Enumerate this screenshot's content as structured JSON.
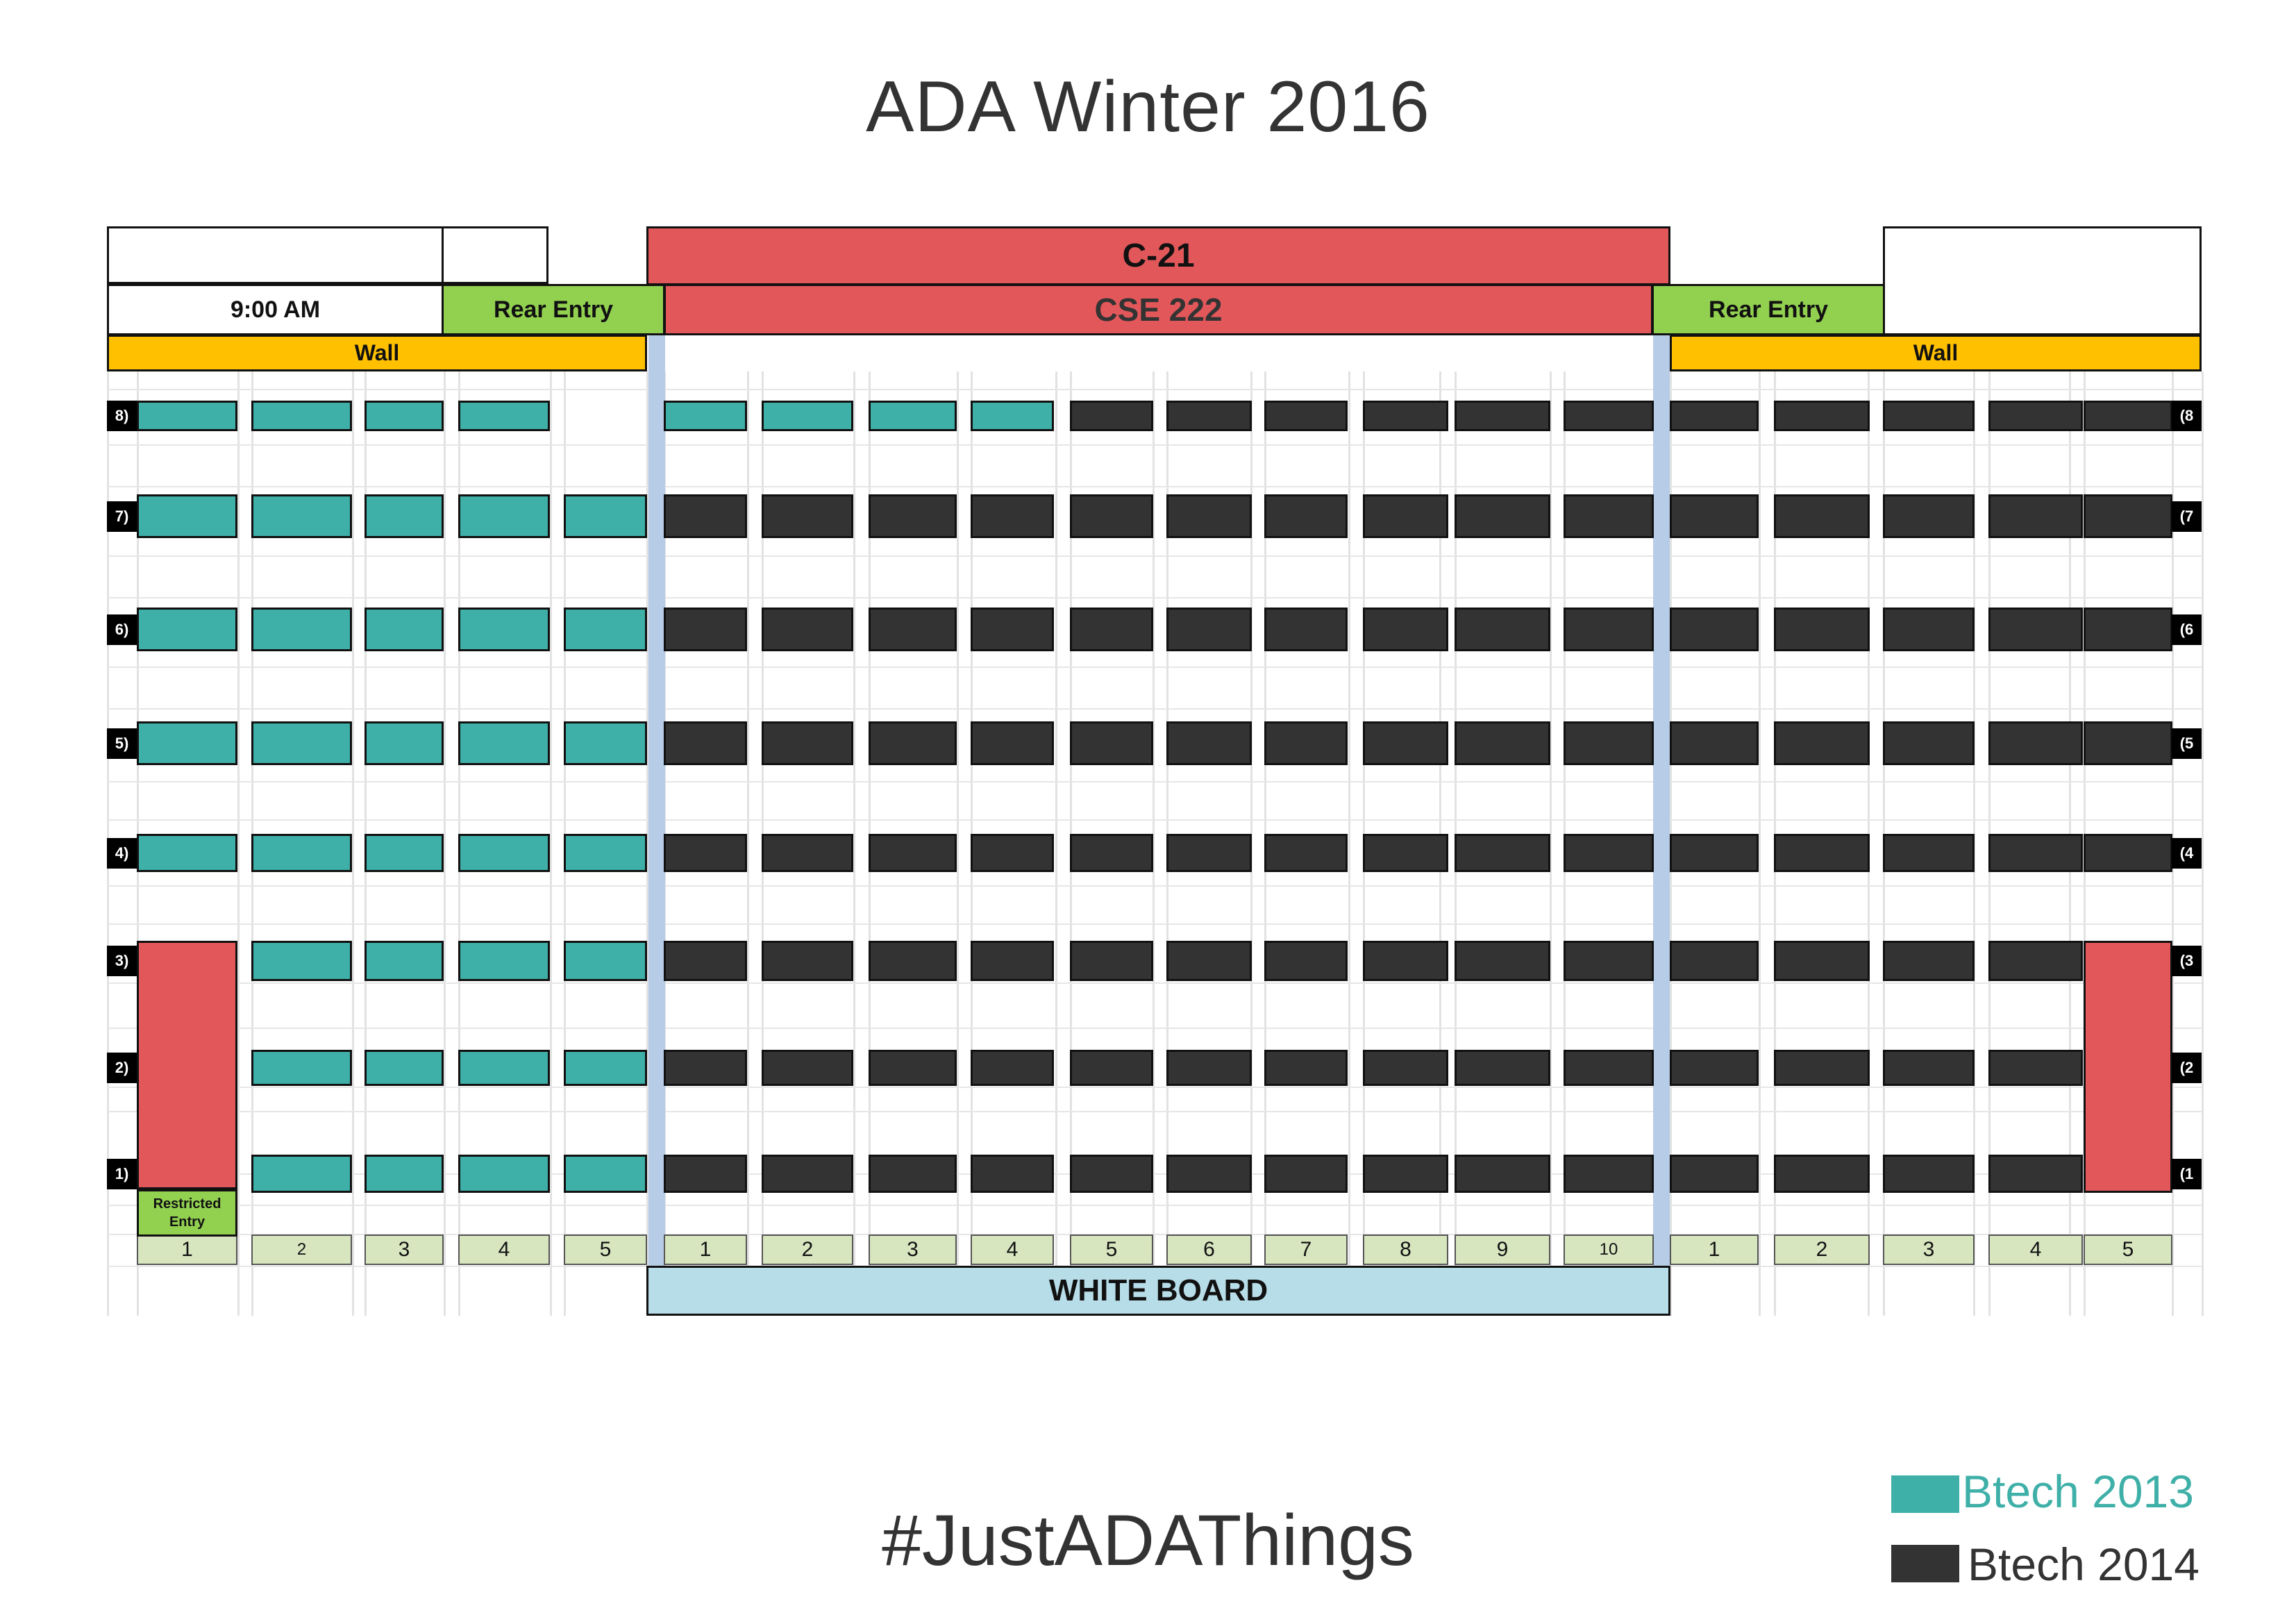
{
  "title": "ADA Winter 2016",
  "hashtag": "#JustADAThings",
  "header": {
    "c21": "C-21",
    "course": "CSE 222",
    "time": "9:00 AM",
    "rear_entry_left": "Rear Entry",
    "rear_entry_right": "Rear Entry",
    "wall_left": "Wall",
    "wall_right": "Wall",
    "whiteboard": "WHITE BOARD",
    "restricted": [
      "Restricted",
      "Entry"
    ]
  },
  "legend": [
    {
      "label": "Btech 2013",
      "color": "#3fb0a8"
    },
    {
      "label": "Btech 2014",
      "color": "#333333"
    }
  ],
  "colors": {
    "teal": "#3fb0a8",
    "dark": "#333333",
    "red": "#e2575a",
    "green": "#92d050",
    "yellow": "#ffc000",
    "whiteboard": "#b7dde8",
    "aisle": "#b7cce6"
  },
  "rows_left": [
    "8)",
    "7)",
    "6)",
    "5)",
    "4)",
    "3)",
    "2)",
    "1)"
  ],
  "rows_right": [
    "(8",
    "(7",
    "(6",
    "(5",
    "(4",
    "(3",
    "(2",
    "(1"
  ],
  "columns": {
    "left": [
      "1",
      "2",
      "3",
      "4",
      "5"
    ],
    "center": [
      "1",
      "2",
      "3",
      "4",
      "5",
      "6",
      "7",
      "8",
      "9",
      "10"
    ],
    "right": [
      "1",
      "2",
      "3",
      "4",
      "5"
    ]
  },
  "seating": {
    "row_8": [
      "B13",
      "B13",
      "B13",
      "B13",
      "empty",
      "B13",
      "B13",
      "B13",
      "B13",
      "B14",
      "B14",
      "B14",
      "B14",
      "B14",
      "B14",
      "B14",
      "B14",
      "B14",
      "B14",
      "B14"
    ],
    "row_7": [
      "B13",
      "B13",
      "B13",
      "B13",
      "B13",
      "B14",
      "B14",
      "B14",
      "B14",
      "B14",
      "B14",
      "B14",
      "B14",
      "B14",
      "B14",
      "B14",
      "B14",
      "B14",
      "B14",
      "B14"
    ],
    "row_6": [
      "B13",
      "B13",
      "B13",
      "B13",
      "B13",
      "B14",
      "B14",
      "B14",
      "B14",
      "B14",
      "B14",
      "B14",
      "B14",
      "B14",
      "B14",
      "B14",
      "B14",
      "B14",
      "B14",
      "B14"
    ],
    "row_5": [
      "B13",
      "B13",
      "B13",
      "B13",
      "B13",
      "B14",
      "B14",
      "B14",
      "B14",
      "B14",
      "B14",
      "B14",
      "B14",
      "B14",
      "B14",
      "B14",
      "B14",
      "B14",
      "B14",
      "B14"
    ],
    "row_4": [
      "B13",
      "B13",
      "B13",
      "B13",
      "B13",
      "B14",
      "B14",
      "B14",
      "B14",
      "B14",
      "B14",
      "B14",
      "B14",
      "B14",
      "B14",
      "B14",
      "B14",
      "B14",
      "B14",
      "B14"
    ],
    "row_3": [
      "restricted",
      "B13",
      "B13",
      "B13",
      "B13",
      "B14",
      "B14",
      "B14",
      "B14",
      "B14",
      "B14",
      "B14",
      "B14",
      "B14",
      "B14",
      "B14",
      "B14",
      "B14",
      "B14",
      "restricted"
    ],
    "row_2": [
      "restricted",
      "B13",
      "B13",
      "B13",
      "B13",
      "B14",
      "B14",
      "B14",
      "B14",
      "B14",
      "B14",
      "B14",
      "B14",
      "B14",
      "B14",
      "B14",
      "B14",
      "B14",
      "B14",
      "restricted"
    ],
    "row_1": [
      "restricted",
      "B13",
      "B13",
      "B13",
      "B13",
      "B14",
      "B14",
      "B14",
      "B14",
      "B14",
      "B14",
      "B14",
      "B14",
      "B14",
      "B14",
      "B14",
      "B14",
      "B14",
      "B14",
      "restricted"
    ]
  }
}
